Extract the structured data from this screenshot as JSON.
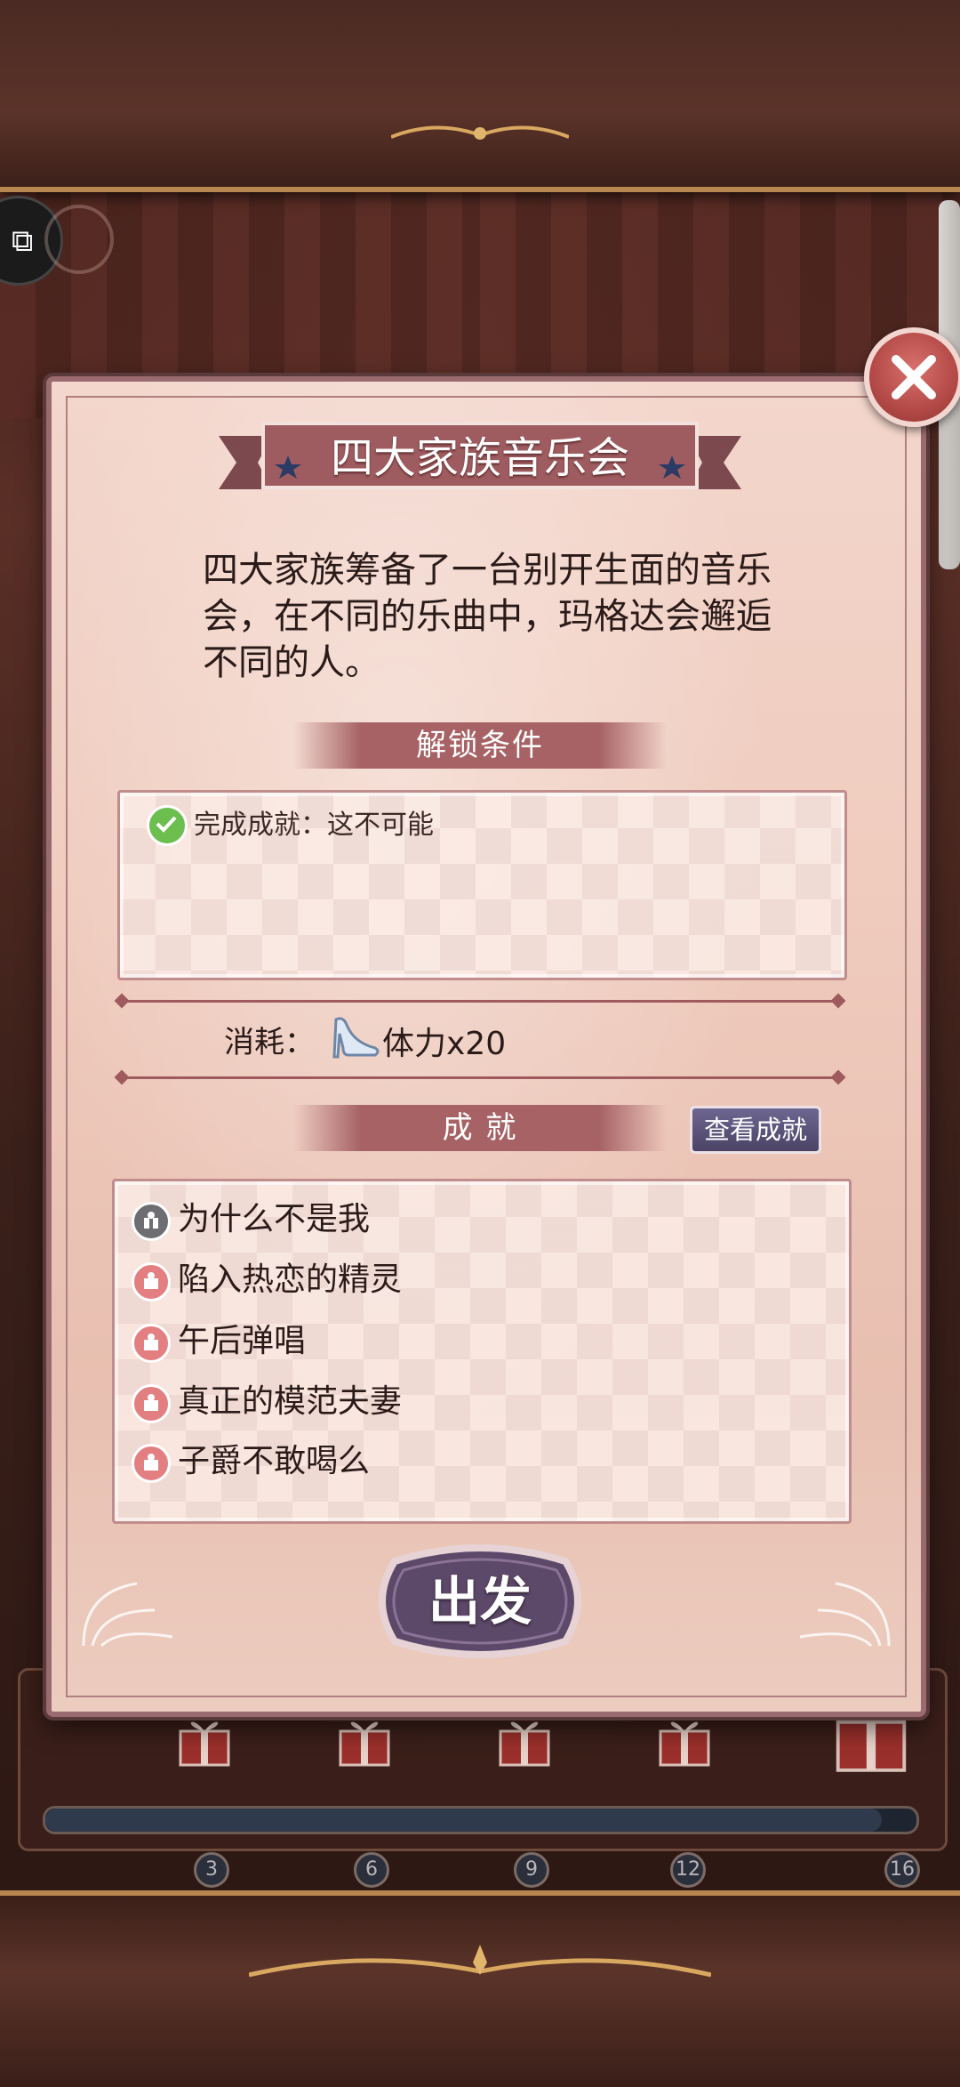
{
  "dialog": {
    "title": "四大家族音乐会",
    "description": "四大家族筹备了一台别开生面的音乐会，在不同的乐曲中，玛格达会邂逅不同的人。",
    "unlock_section_label": "解锁条件",
    "unlock_condition": "完成成就：这不可能",
    "cost_label": "消耗：",
    "cost_value": "体力x20",
    "achievements_section_label": "成 就",
    "view_achievements_label": "查看成就",
    "achievements": [
      {
        "label": "为什么不是我",
        "status": "locked"
      },
      {
        "label": "陷入热恋的精灵",
        "status": "unlocked"
      },
      {
        "label": "午后弹唱",
        "status": "unlocked"
      },
      {
        "label": "真正的模范夫妻",
        "status": "unlocked"
      },
      {
        "label": "子爵不敢喝么",
        "status": "unlocked"
      }
    ],
    "go_button_label": "出发"
  },
  "progress": {
    "fraction": 0.96,
    "milestones": [
      "3",
      "6",
      "9",
      "12",
      "16"
    ]
  },
  "colors": {
    "accent": "#a76265",
    "button_purple": "#4b4466",
    "close_red": "#b44a47",
    "check_green": "#6cbf4f"
  }
}
